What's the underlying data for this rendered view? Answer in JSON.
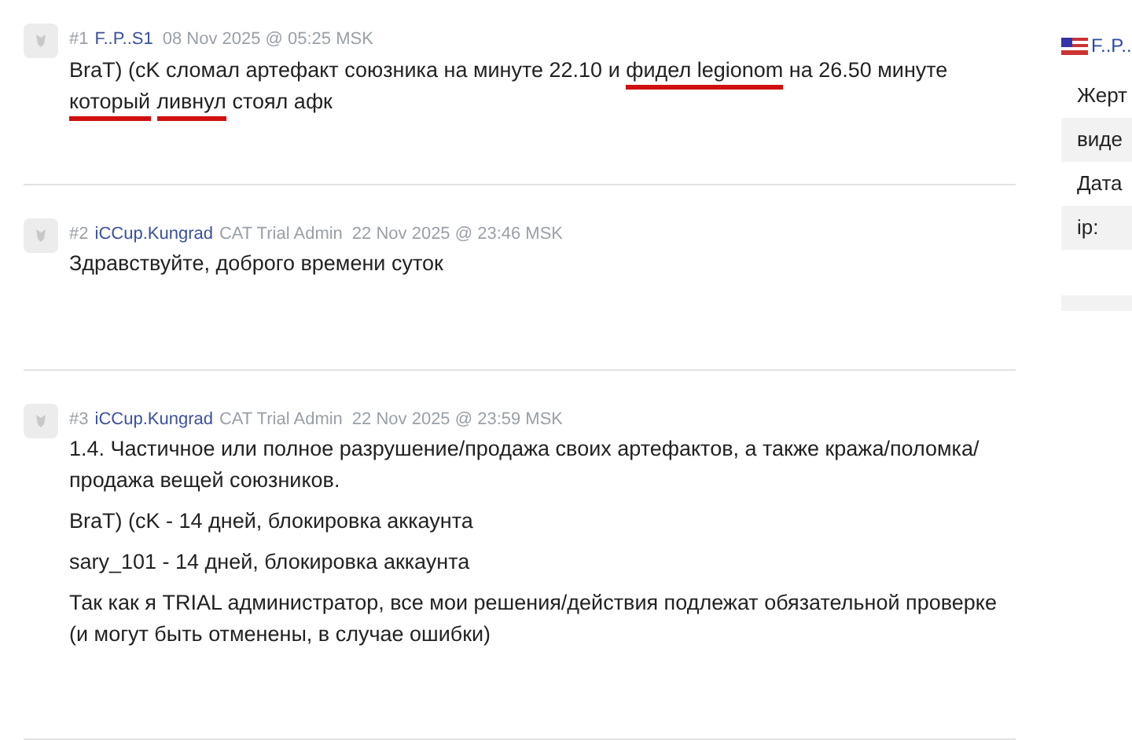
{
  "posts": [
    {
      "number": "#1",
      "author": "F..P..S1",
      "date": "08 Nov 2025 @ 05:25 MSK",
      "paragraphs": [
        [
          {
            "text": "BraT) (cK сломал артефакт союзника на минуте 22.10 и ",
            "underlined": false
          },
          {
            "text": "фидел legionom",
            "underlined": true
          },
          {
            "text": " на 26.50 минуте ",
            "underlined": false
          },
          {
            "text": "который",
            "underlined": true
          },
          {
            "text": "ливнул",
            "underlined": true
          },
          {
            "text": " стоял афк",
            "underlined": false
          }
        ]
      ]
    },
    {
      "number": "#2",
      "author": "iCCup.Kungrad",
      "role": "CAT Trial Admin",
      "date": "22 Nov 2025 @ 23:46 MSK",
      "paragraphs": [
        [
          {
            "text": "Здравствуйте, доброго времени суток",
            "underlined": false
          }
        ]
      ]
    },
    {
      "number": "#3",
      "author": "iCCup.Kungrad",
      "role": "CAT Trial Admin",
      "date": "22 Nov 2025 @ 23:59 MSK",
      "paragraphs": [
        [
          {
            "text": "1.4. Частичное или полное разрушение/продажа своих артефактов, а также кража/поломка/ продажа вещей союзников.",
            "underlined": false
          }
        ],
        [
          {
            "text": "BraT) (cK - 14 дней, блокировка аккаунта",
            "underlined": false
          }
        ],
        [
          {
            "text": "sary_101 - 14 дней, блокировка аккаунта",
            "underlined": false
          }
        ],
        [
          {
            "text": "Так как я TRIAL администратор, все мои решения/действия подлежат обязательной проверке (и могут быть отменены, в случае ошибки)",
            "underlined": false
          }
        ]
      ]
    }
  ],
  "sidebar": {
    "user": "F..P..",
    "rows": [
      {
        "label": "Жерт",
        "shaded": false
      },
      {
        "label": "виде",
        "shaded": true
      },
      {
        "label": "Дата",
        "shaded": false
      },
      {
        "label": "ip:",
        "shaded": true
      }
    ]
  }
}
